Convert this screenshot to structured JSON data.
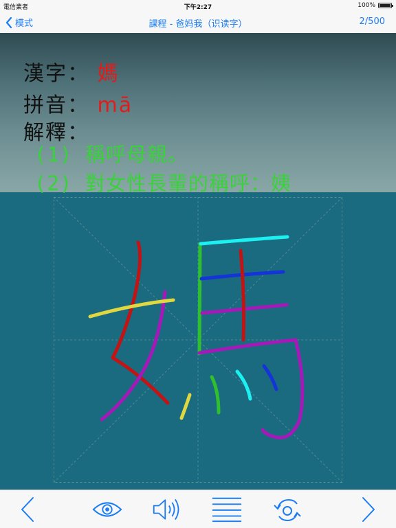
{
  "status": {
    "carrier": "電信業者",
    "time": "下午2:27",
    "battery": "100%"
  },
  "nav": {
    "back_label": "模式",
    "title": "課程 - 爸妈我（识读字）",
    "count": "2/500"
  },
  "card": {
    "char_label": "漢字：",
    "char_value": "媽",
    "pinyin_label": "拼音：",
    "pinyin_value": "mā",
    "def_label": "解釋：",
    "definitions": [
      "(1) 稱呼母親。",
      "(2) 對女性長輩的稱呼：姨"
    ]
  },
  "stroke_colors": [
    "#c21414",
    "#a41ab8",
    "#e0d840",
    "#2fbf2f",
    "#1cf0f0",
    "#1434d8",
    "#a41ab8",
    "#a41ab8",
    "#c21414",
    "#2fbf2f"
  ],
  "toolbar": {
    "items": [
      "previous",
      "view",
      "sound",
      "list",
      "rotate",
      "next"
    ],
    "icon_color": "#1a7cf5"
  }
}
